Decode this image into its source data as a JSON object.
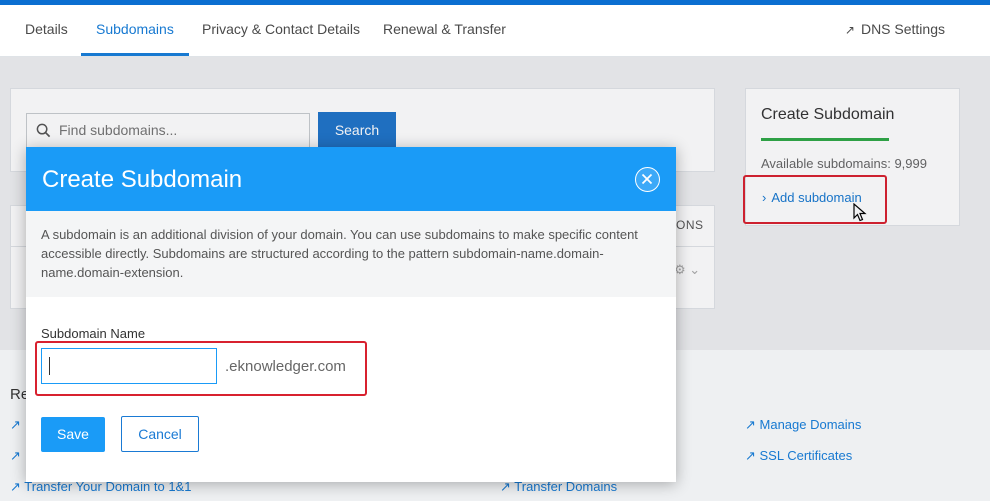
{
  "tabs": [
    {
      "label": "Details"
    },
    {
      "label": "Subdomains"
    },
    {
      "label": "Privacy & Contact Details"
    },
    {
      "label": "Renewal & Transfer"
    }
  ],
  "dns_settings": {
    "label": "DNS Settings",
    "icon": "external-arrow-icon"
  },
  "search": {
    "placeholder": "Find subdomains...",
    "button": "Search"
  },
  "table_header_fragment": "ONS",
  "side": {
    "title": "Create Subdomain",
    "available": "Available subdomains: 9,999",
    "add": "Add subdomain"
  },
  "bottom": {
    "section_fragment": "Re",
    "links": [
      {
        "label": "Transfer Your Domain to 1&1"
      },
      {
        "label": "Transfer Domains"
      },
      {
        "label": "Manage Domains"
      },
      {
        "label": "SSL Certificates"
      }
    ]
  },
  "modal": {
    "title": "Create Subdomain",
    "description": "A subdomain is an additional division of your domain. You can use subdomains to make specific content accessible directly. Subdomains are structured according to the pattern subdomain-name.domain-name.domain-extension.",
    "field_label": "Subdomain Name",
    "field_value": "",
    "suffix": ".eknowledger.com",
    "save": "Save",
    "cancel": "Cancel"
  },
  "colors": {
    "accent": "#1a9bf7",
    "nav_active": "#1779d1",
    "highlight": "#d8212f",
    "progress": "#2fa847"
  }
}
